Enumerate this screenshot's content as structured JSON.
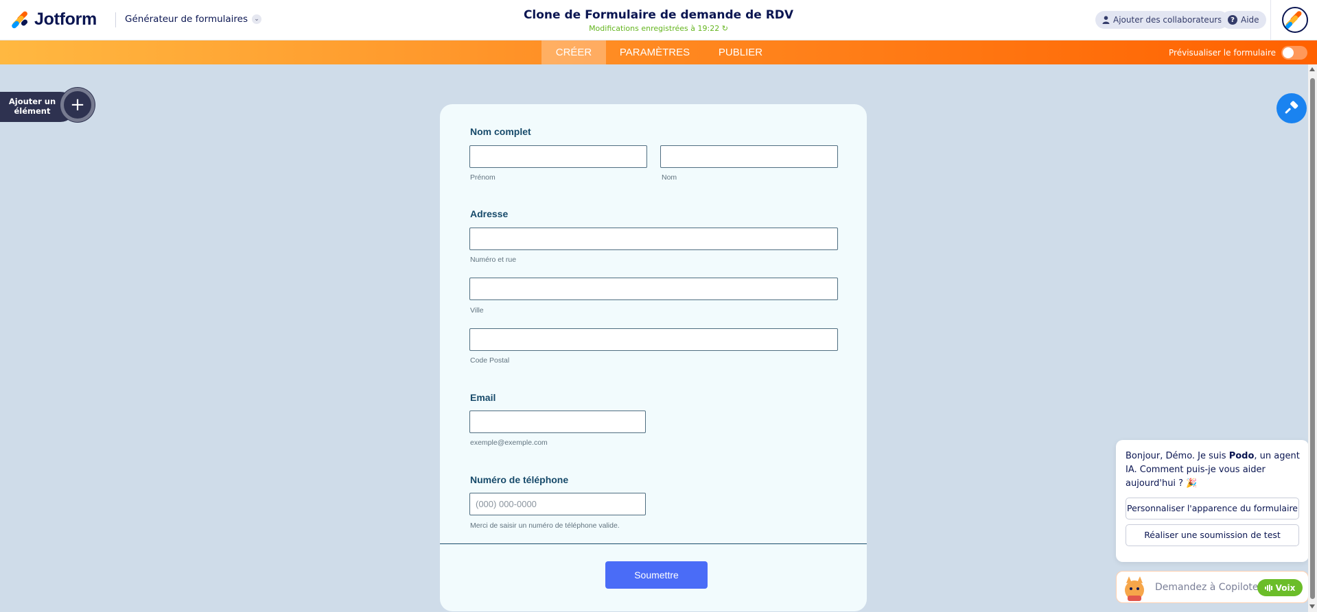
{
  "app": {
    "brand": "Jotform",
    "builder_menu": "Générateur de formulaires",
    "form_title": "Clone de Formulaire de demande de RDV",
    "saved_status": "Modifications enregistrées à 19:22",
    "collab_label": "Ajouter des collaborateurs",
    "help_label": "Aide"
  },
  "nav": {
    "tabs": [
      "CRÉER",
      "PARAMÈTRES",
      "PUBLIER"
    ],
    "active_tab": "CRÉER",
    "preview_label": "Prévisualiser le formulaire",
    "preview_enabled": false
  },
  "sidebar": {
    "add_element_label": "Ajouter un élément"
  },
  "form": {
    "name_label": "Nom complet",
    "first_name_sub": "Prénom",
    "last_name_sub": "Nom",
    "address_label": "Adresse",
    "street_sub": "Numéro et rue",
    "city_sub": "Ville",
    "postal_sub": "Code Postal",
    "email_label": "Email",
    "email_sub": "exemple@exemple.com",
    "phone_label": "Numéro de téléphone",
    "phone_placeholder": "(000) 000-0000",
    "phone_sub": "Merci de saisir un numéro de téléphone valide.",
    "submit_label": "Soumettre"
  },
  "copilot": {
    "greeting_pre": "Bonjour, Démo. Je suis ",
    "agent_name": "Podo",
    "greeting_post": ", un agent IA. Comment puis-je vous aider aujourd'hui ? 🎉",
    "suggestions": [
      "Personnaliser l'apparence du formulaire",
      "Réaliser une soumission de test"
    ],
    "ask_placeholder": "Demandez à Copilote",
    "voice_label": "Voix"
  },
  "colors": {
    "brand_navy": "#0a1551",
    "nav_orange_start": "#ffb841",
    "nav_orange_end": "#ff6100",
    "canvas_bg": "#cfdce9",
    "submit_blue": "#4a6cf7",
    "saved_green": "#64b51e"
  }
}
